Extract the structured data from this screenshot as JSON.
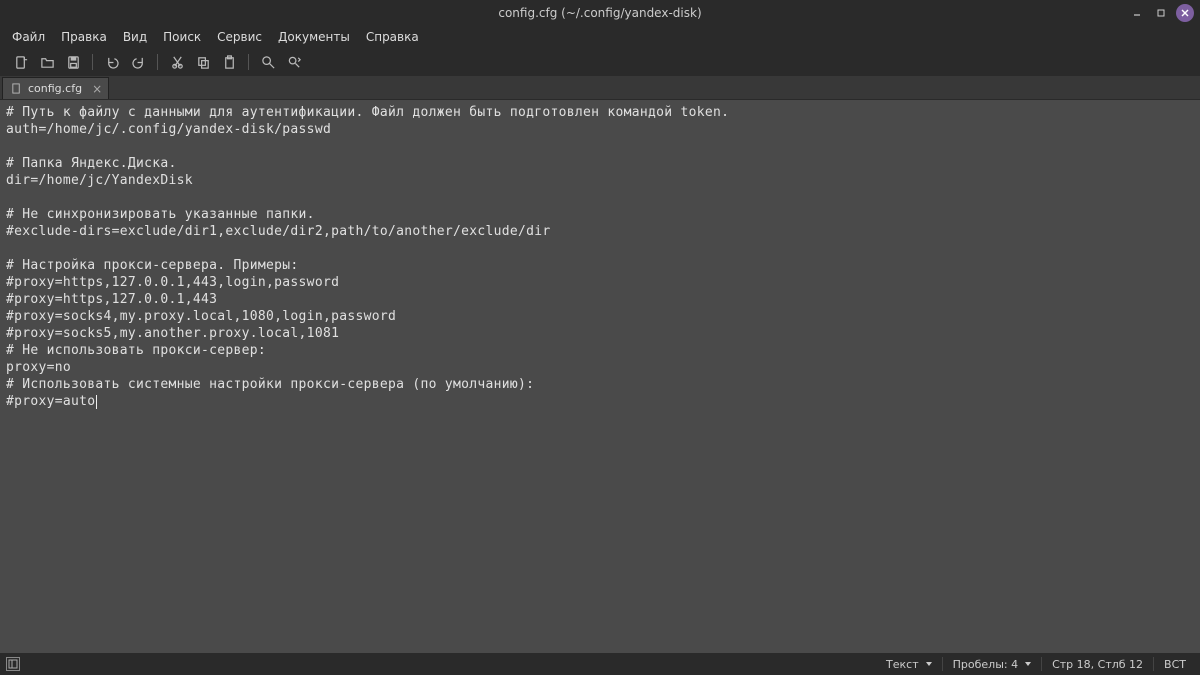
{
  "window": {
    "title": "config.cfg (~/.config/yandex-disk)"
  },
  "menu": {
    "items": [
      "Файл",
      "Правка",
      "Вид",
      "Поиск",
      "Сервис",
      "Документы",
      "Справка"
    ]
  },
  "toolbar": {
    "icons": [
      "new-file",
      "open-file",
      "save-file",
      "sep",
      "undo",
      "redo",
      "sep",
      "cut",
      "copy",
      "paste",
      "sep",
      "find",
      "find-replace"
    ]
  },
  "tab": {
    "name": "config.cfg"
  },
  "editor": {
    "lines": [
      "# Путь к файлу с данными для аутентификации. Файл должен быть подготовлен командой token.",
      "auth=/home/jc/.config/yandex-disk/passwd",
      "",
      "# Папка Яндекс.Диска.",
      "dir=/home/jc/YandexDisk",
      "",
      "# Не синхронизировать указанные папки.",
      "#exclude-dirs=exclude/dir1,exclude/dir2,path/to/another/exclude/dir",
      "",
      "# Настройка прокси-сервера. Примеры:",
      "#proxy=https,127.0.0.1,443,login,password",
      "#proxy=https,127.0.0.1,443",
      "#proxy=socks4,my.proxy.local,1080,login,password",
      "#proxy=socks5,my.another.proxy.local,1081",
      "# Не использовать прокси-сервер:",
      "proxy=no",
      "# Использовать системные настройки прокси-сервера (по умолчанию):",
      "#proxy=auto"
    ]
  },
  "status": {
    "syntax": "Текст",
    "tabwidth": "Пробелы: 4",
    "position": "Стр 18, Стлб 12",
    "mode": "ВСТ"
  }
}
